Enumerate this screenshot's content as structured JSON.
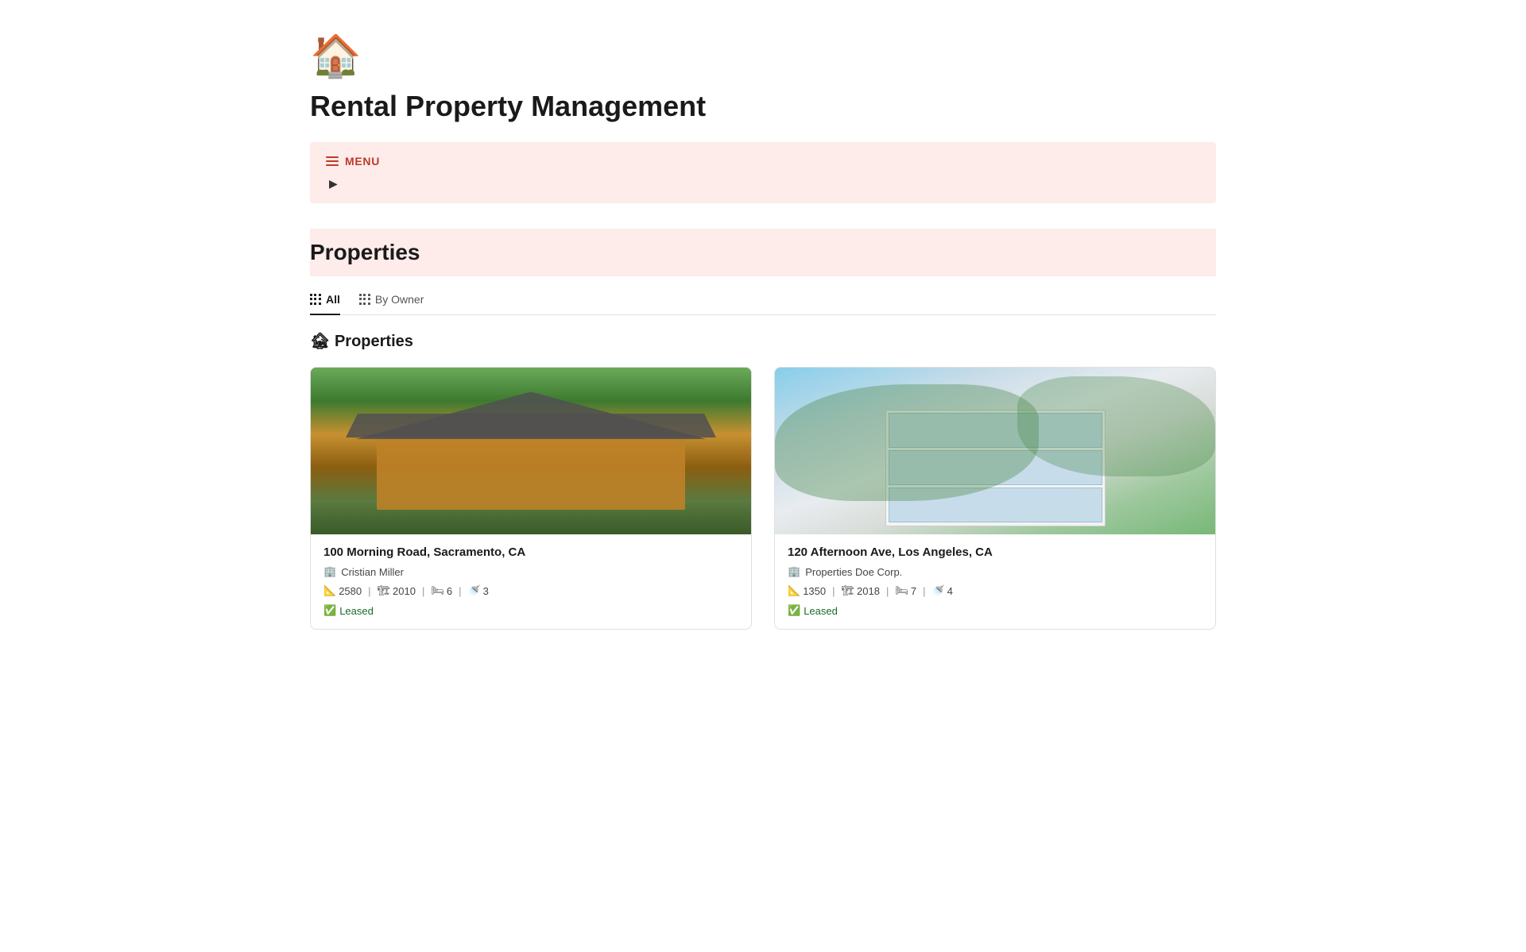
{
  "app": {
    "icon": "🏠",
    "title": "Rental Property Management"
  },
  "menu": {
    "label": "MENU",
    "arrow": "▶"
  },
  "properties_section": {
    "title": "Properties"
  },
  "tabs": [
    {
      "id": "all",
      "label": "All",
      "active": true
    },
    {
      "id": "by-owner",
      "label": "By Owner",
      "active": false
    }
  ],
  "properties_group_title": "🏚 Properties",
  "properties": [
    {
      "id": "prop-1",
      "address": "100 Morning Road, Sacramento, CA",
      "owner": "Cristian Miller",
      "sqft": "2580",
      "year": "2010",
      "beds": "6",
      "baths": "3",
      "status": "Leased",
      "status_emoji": "✅",
      "image_style": "1"
    },
    {
      "id": "prop-2",
      "address": "120 Afternoon Ave, Los Angeles, CA",
      "owner": "Properties Doe Corp.",
      "sqft": "1350",
      "year": "2018",
      "beds": "7",
      "baths": "4",
      "status": "Leased",
      "status_emoji": "✅",
      "image_style": "2"
    }
  ],
  "icons": {
    "sqft": "📐",
    "year": "🏗",
    "bed": "🛏",
    "bath": "🚿",
    "owner": "🏢"
  }
}
